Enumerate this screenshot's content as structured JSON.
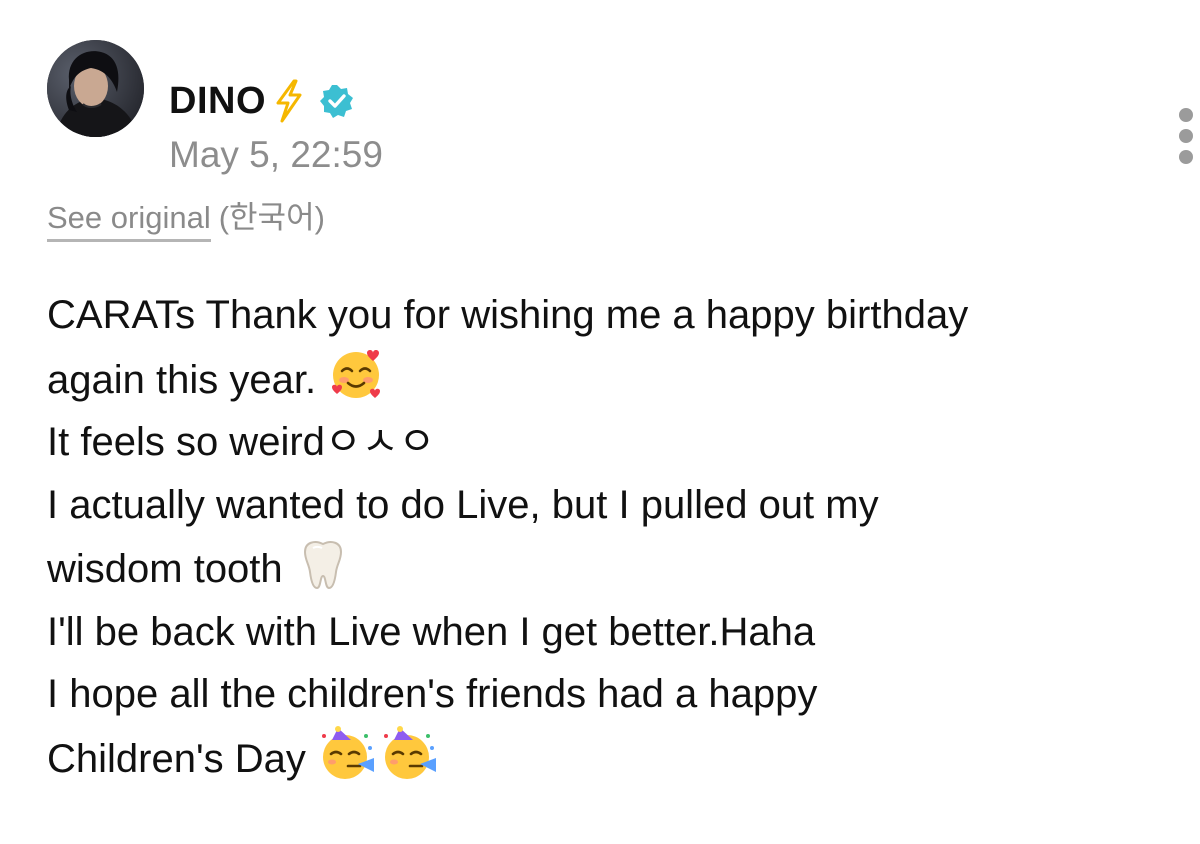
{
  "post": {
    "author": {
      "name": "DINO",
      "name_emoji": "lightning-bolt",
      "verified": true,
      "avatar": "avatar"
    },
    "timestamp": "May 5, 22:59",
    "more_menu_icon": "more-vertical-icon",
    "translation": {
      "see_original_label": "See original",
      "original_language": "(한국어)"
    },
    "body_lines": [
      {
        "text": "CARATs Thank you for wishing me a happy birthday",
        "emoji": []
      },
      {
        "text": "again this year.",
        "emoji": [
          "smiling-face-with-hearts"
        ]
      },
      {
        "text": "It feels so weirdㅇㅅㅇ",
        "emoji": []
      },
      {
        "text": "I actually wanted to do Live, but I pulled out my",
        "emoji": []
      },
      {
        "text": "wisdom tooth",
        "emoji": [
          "tooth"
        ]
      },
      {
        "text": "I'll be back with Live when I get better.Haha",
        "emoji": []
      },
      {
        "text": "I hope all the children's friends had a happy",
        "emoji": []
      },
      {
        "text": "Children's Day",
        "emoji": [
          "partying-face",
          "partying-face"
        ]
      }
    ],
    "colors": {
      "verified_badge": "#3cbfd2",
      "lightning": "#f5b700",
      "muted_text": "#8d8d8d"
    }
  }
}
